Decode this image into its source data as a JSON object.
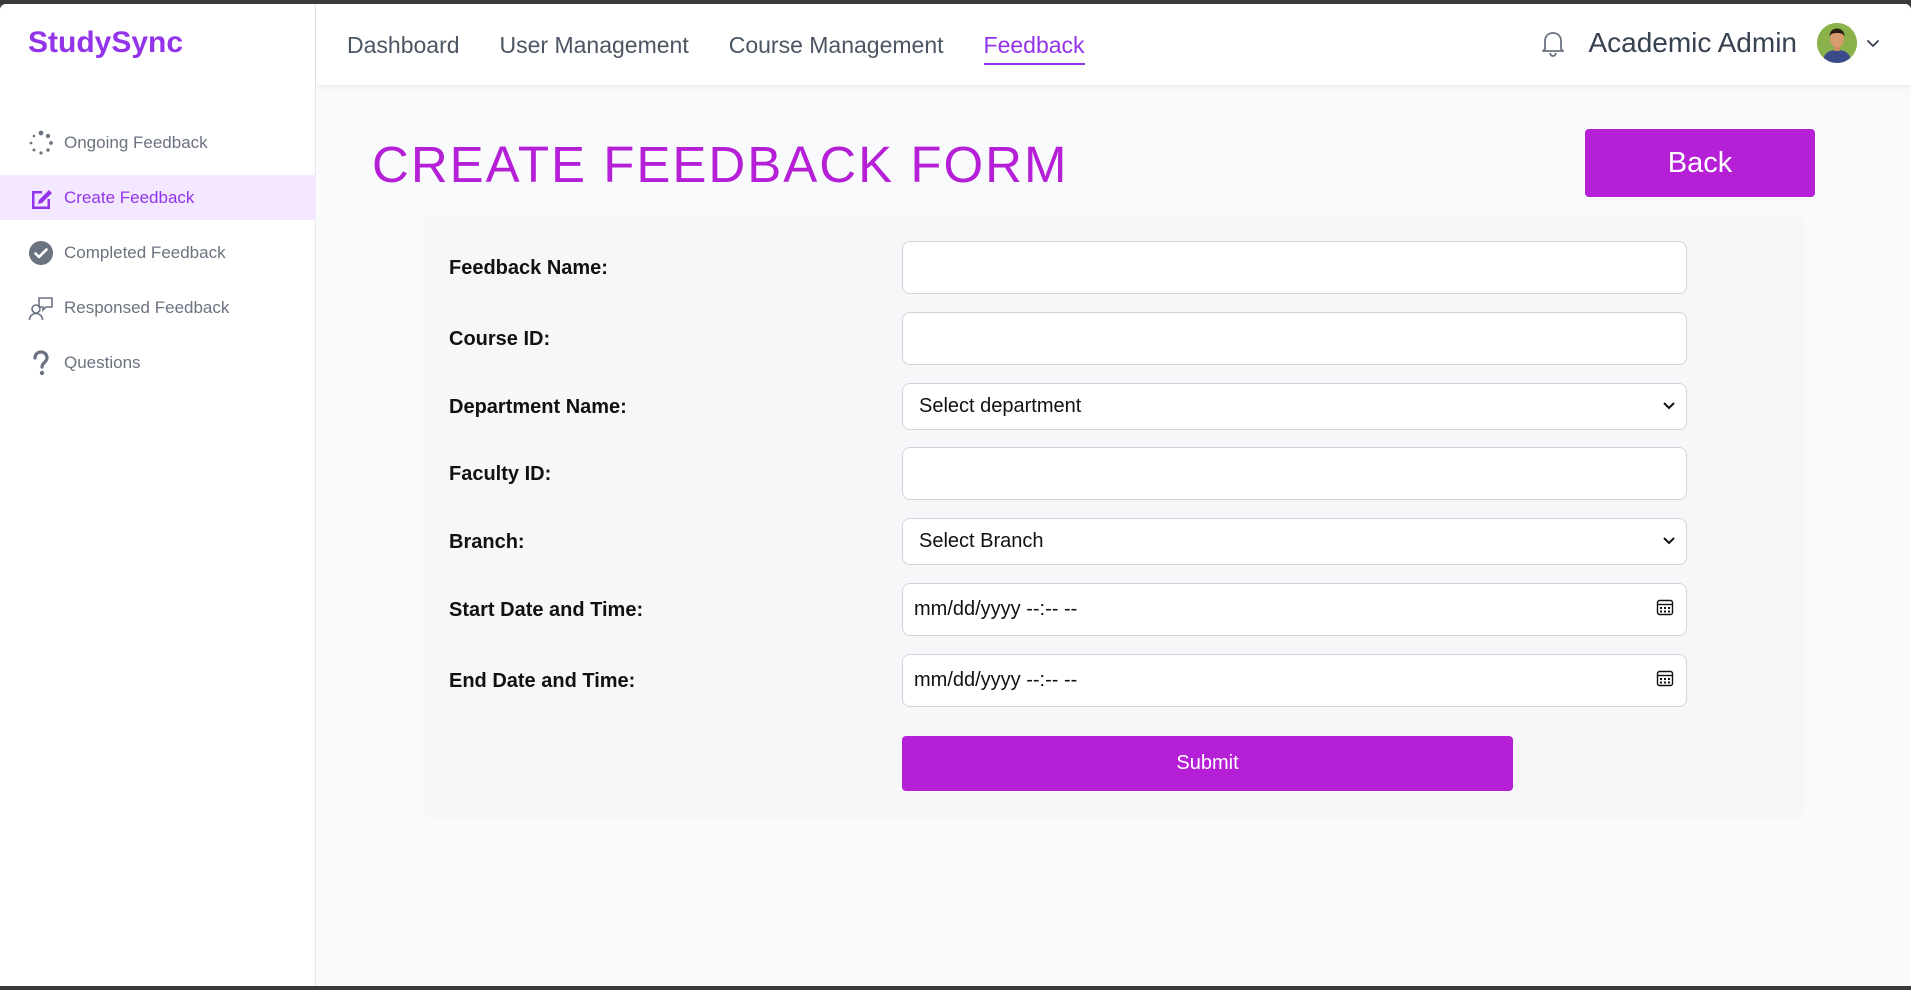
{
  "app": {
    "brand": "StudySync"
  },
  "sidebar": {
    "items": [
      {
        "label": "Ongoing Feedback",
        "icon": "spinner-icon",
        "active": false
      },
      {
        "label": "Create Feedback",
        "icon": "edit-icon",
        "active": true
      },
      {
        "label": "Completed Feedback",
        "icon": "check-circle-icon",
        "active": false
      },
      {
        "label": "Responsed Feedback",
        "icon": "user-chat-icon",
        "active": false
      },
      {
        "label": "Questions",
        "icon": "question-icon",
        "active": false
      }
    ]
  },
  "topnav": {
    "items": [
      {
        "label": "Dashboard",
        "active": false
      },
      {
        "label": "User Management",
        "active": false
      },
      {
        "label": "Course Management",
        "active": false
      },
      {
        "label": "Feedback",
        "active": true
      }
    ],
    "user_name": "Academic Admin"
  },
  "page": {
    "title": "CREATE FEEDBACK FORM",
    "back_label": "Back"
  },
  "form": {
    "feedback_name": {
      "label": "Feedback Name:",
      "value": ""
    },
    "course_id": {
      "label": "Course ID:",
      "value": ""
    },
    "department": {
      "label": "Department Name:",
      "selected": "Select department"
    },
    "faculty_id": {
      "label": "Faculty ID:",
      "value": ""
    },
    "branch": {
      "label": "Branch:",
      "selected": "Select Branch"
    },
    "start": {
      "label": "Start Date and Time:",
      "placeholder": "mm/dd/yyyy --:-- --"
    },
    "end": {
      "label": "End Date and Time:",
      "placeholder": "mm/dd/yyyy --:-- --"
    },
    "submit_label": "Submit"
  },
  "colors": {
    "brand": "#9333ea",
    "accent": "#b51fd6",
    "active_bg": "#f3e8ff"
  }
}
